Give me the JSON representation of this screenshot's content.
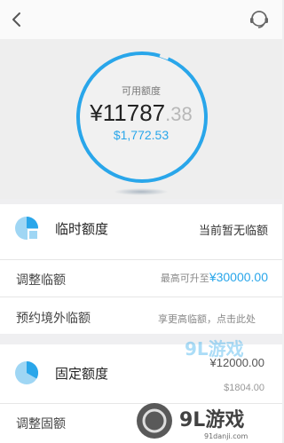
{
  "header": {
    "back_icon": "chevron-left-icon",
    "service_icon": "customer-service-icon"
  },
  "available": {
    "label": "可用额度",
    "amount_main": "¥11787",
    "amount_decimal": ".38",
    "amount_usd": "$1,772.53",
    "ring_color": "#29a6ea"
  },
  "temp_credit": {
    "icon": "pie-chart-icon",
    "title": "临时额度",
    "status": "当前暂无临额",
    "adjust_label": "调整临额",
    "adjust_hint": "最高可升至",
    "adjust_max": "¥30000.00",
    "overseas_label": "预约境外临额",
    "overseas_hint": "享更高临额，点击此处"
  },
  "fixed_credit": {
    "icon": "pie-chart-icon",
    "title": "固定额度",
    "amount_cny": "¥12000.00",
    "amount_usd": "$1804.00",
    "adjust_label": "调整固额"
  },
  "watermark": {
    "brand": "9L游戏",
    "domain": "91danji.com"
  },
  "colors": {
    "accent": "#29a6ea",
    "pie_light": "#9fd6f4"
  }
}
